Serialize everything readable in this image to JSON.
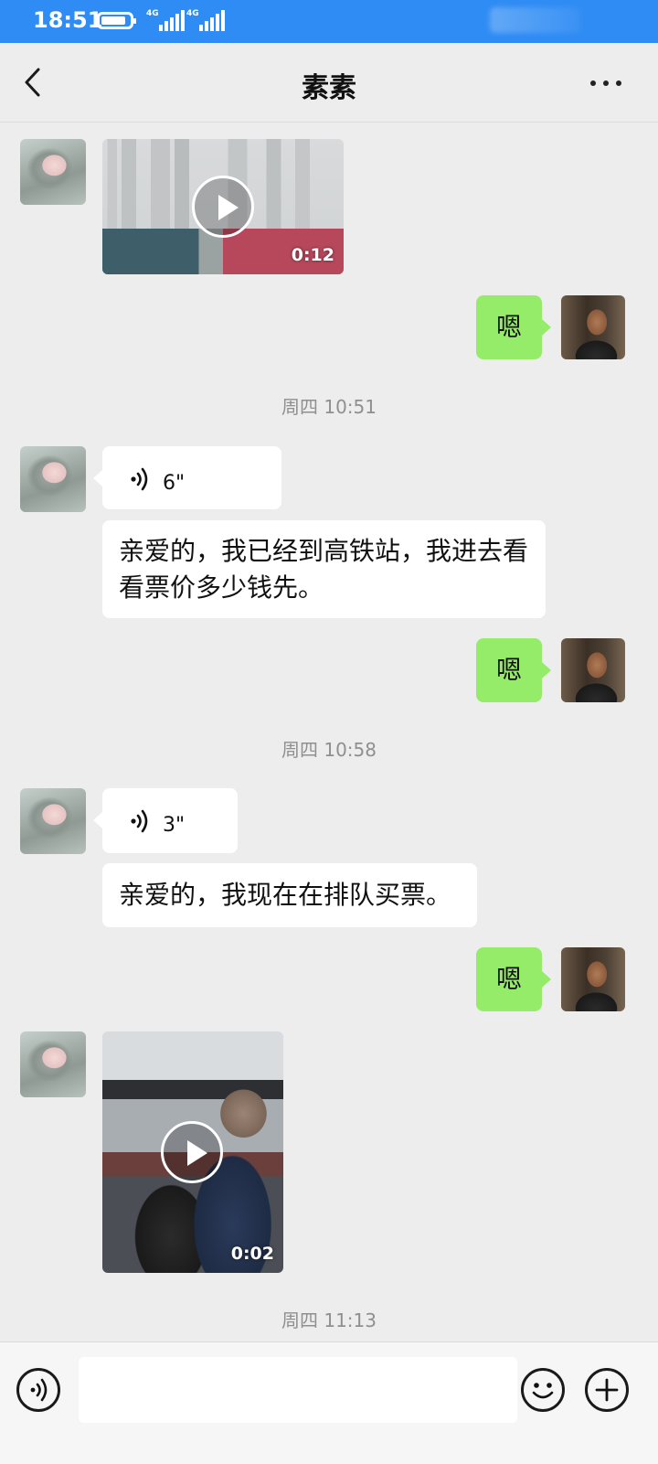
{
  "status_bar": {
    "time": "18:51",
    "network_1": "4G",
    "network_2": "4G"
  },
  "header": {
    "title": "素素",
    "back_icon": "chevron-left-icon",
    "more_icon": "more-dots-icon"
  },
  "messages": [
    {
      "side": "in",
      "type": "video",
      "duration": "0:12"
    },
    {
      "side": "out",
      "type": "text",
      "text": "嗯"
    },
    {
      "type": "timestamp",
      "text": "周四 10:51"
    },
    {
      "side": "in",
      "type": "voice",
      "duration": "6\""
    },
    {
      "side": "in",
      "type": "text",
      "text": "亲爱的，我已经到高铁站，我进去看看票价多少钱先。"
    },
    {
      "side": "out",
      "type": "text",
      "text": "嗯"
    },
    {
      "type": "timestamp",
      "text": "周四 10:58"
    },
    {
      "side": "in",
      "type": "voice",
      "duration": "3\""
    },
    {
      "side": "in",
      "type": "text",
      "text": "亲爱的，我现在在排队买票。"
    },
    {
      "side": "out",
      "type": "text",
      "text": "嗯"
    },
    {
      "side": "in",
      "type": "video",
      "duration": "0:02"
    },
    {
      "type": "timestamp",
      "text": "周四 11:13"
    }
  ],
  "input_bar": {
    "voice_icon": "voice-input-icon",
    "emoji_icon": "emoji-icon",
    "plus_icon": "plus-icon",
    "text_value": ""
  },
  "colors": {
    "status_bar": "#2f8cf4",
    "outgoing_bubble": "#95ec69",
    "background": "#ededed"
  }
}
